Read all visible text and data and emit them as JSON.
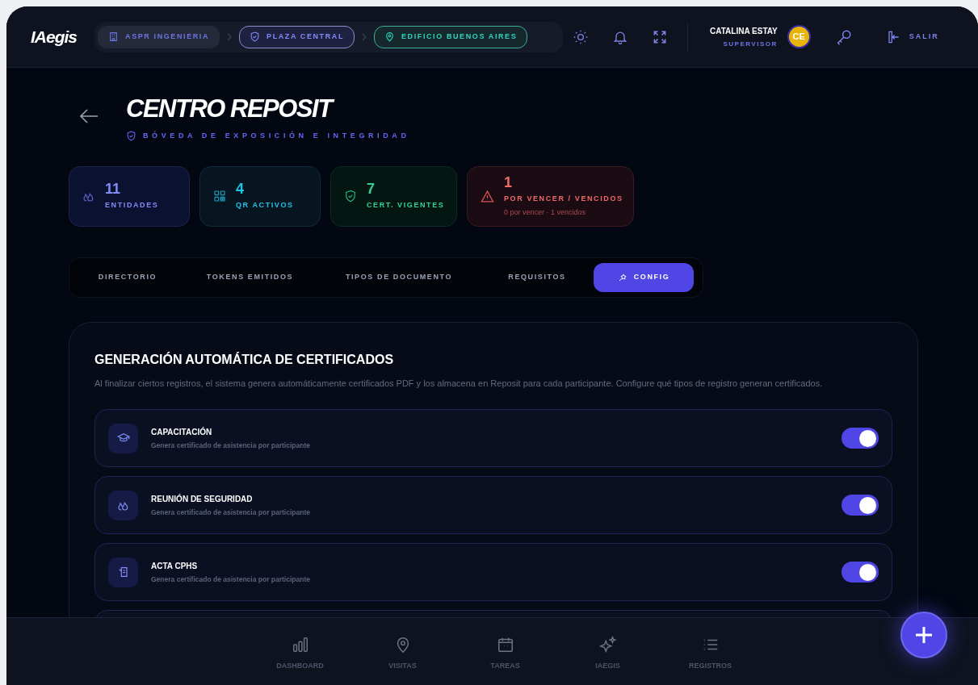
{
  "header": {
    "logo": "IAegis",
    "breadcrumbs": [
      {
        "label": "ASPR INGENIERIA",
        "kind": "company"
      },
      {
        "label": "PLAZA CENTRAL",
        "kind": "site"
      },
      {
        "label": "EDIFICIO BUENOS AIRES",
        "kind": "building"
      }
    ],
    "user": {
      "name": "CATALINA ESTAY",
      "role": "SUPERVISOR",
      "initials": "CE"
    },
    "logout": "SALIR"
  },
  "page": {
    "title": "CENTRO REPOSIT",
    "subtitle": "BÓVEDA DE EXPOSICIÓN E INTEGRIDAD"
  },
  "stats": [
    {
      "kind": "entities",
      "value": "11",
      "label": "ENTIDADES"
    },
    {
      "kind": "qr",
      "value": "4",
      "label": "QR ACTIVOS"
    },
    {
      "kind": "certs",
      "value": "7",
      "label": "CERT. VIGENTES"
    },
    {
      "kind": "alert",
      "value": "1",
      "label": "POR VENCER / VENCIDOS",
      "detail": "0 por vencer · 1 vencidos"
    }
  ],
  "tabs": [
    {
      "label": "DIRECTORIO",
      "selected": false
    },
    {
      "label": "TOKENS EMITIDOS",
      "selected": false
    },
    {
      "label": "TIPOS DE DOCUMENTO",
      "selected": false
    },
    {
      "label": "REQUISITOS",
      "selected": false
    },
    {
      "label": "CONFIG",
      "selected": true
    }
  ],
  "panel": {
    "title": "GENERACIÓN AUTOMÁTICA DE CERTIFICADOS",
    "description": "Al finalizar ciertos registros, el sistema genera automáticamente certificados PDF y los almacena en Reposit para cada participante. Configure qué tipos de registro generan certificados.",
    "items": [
      {
        "kind": "training",
        "title": "CAPACITACIÓN",
        "description": "Genera certificado de asistencia por participante",
        "on": true
      },
      {
        "kind": "meeting",
        "title": "REUNIÓN DE SEGURIDAD",
        "description": "Genera certificado de asistencia por participante",
        "on": true
      },
      {
        "kind": "minutes",
        "title": "ACTA CPHS",
        "description": "Genera certificado de asistencia por participante",
        "on": true
      }
    ]
  },
  "bottom_nav": [
    {
      "kind": "dashboard",
      "label": "DASHBOARD"
    },
    {
      "kind": "visits",
      "label": "VISITAS"
    },
    {
      "kind": "tasks",
      "label": "TAREAS"
    },
    {
      "kind": "ai",
      "label": "IAEGIS"
    },
    {
      "kind": "records",
      "label": "REGISTROS"
    }
  ]
}
